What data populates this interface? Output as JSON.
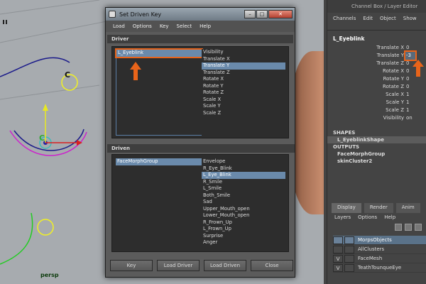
{
  "viewport": {
    "camera_label": "persp"
  },
  "channel_box": {
    "title": "Channel Box / Layer Editor",
    "menu": [
      "Channels",
      "Edit",
      "Object",
      "Show"
    ],
    "object": "L_Eyeblink",
    "attributes": [
      {
        "name": "Translate X",
        "value": "0"
      },
      {
        "name": "Translate Y",
        "value": "-3"
      },
      {
        "name": "Translate Z",
        "value": "0"
      },
      {
        "name": "Rotate X",
        "value": "0"
      },
      {
        "name": "Rotate Y",
        "value": "0"
      },
      {
        "name": "Rotate Z",
        "value": "0"
      },
      {
        "name": "Scale X",
        "value": "1"
      },
      {
        "name": "Scale Y",
        "value": "1"
      },
      {
        "name": "Scale Z",
        "value": "1"
      },
      {
        "name": "Visibility",
        "value": "on"
      }
    ],
    "shapes_header": "SHAPES",
    "shapes": [
      "L_EyeblinkShape"
    ],
    "outputs_header": "OUTPUTS",
    "outputs": [
      "FaceMorphGroup",
      "skinCluster2"
    ]
  },
  "layers": {
    "tabs": [
      "Display",
      "Render",
      "Anim"
    ],
    "menu": [
      "Layers",
      "Options",
      "Help"
    ],
    "rows": [
      {
        "v": "",
        "name": "MorpsObjects"
      },
      {
        "v": "",
        "name": "AllClusters"
      },
      {
        "v": "V",
        "name": "FaceMesh"
      },
      {
        "v": "V",
        "name": "TeathTounqueEye"
      }
    ]
  },
  "dialog": {
    "title": "Set Driven Key",
    "menu": [
      "Load",
      "Options",
      "Key",
      "Select",
      "Help"
    ],
    "driver_header": "Driver",
    "driver_nodes": [
      "L_Eyeblink"
    ],
    "driver_attrs": [
      "Visibility",
      "Translate X",
      "Translate Y",
      "Translate Z",
      "Rotate X",
      "Rotate Y",
      "Rotate Z",
      "Scale X",
      "Scale Y",
      "Scale Z"
    ],
    "driver_selected_attr": "Translate Y",
    "driven_header": "Driven",
    "driven_nodes": [
      "FaceMorphGroup"
    ],
    "driven_attrs": [
      "Envelope",
      "R_Eye_Blink",
      "L_Eye_Blink",
      "R_Smile",
      "L_Smile",
      "Both_Smile",
      "Sad",
      "Upper_Mouth_open",
      "Lower_Mouth_open",
      "R_Frown_Up",
      "L_Frown_Up",
      "Surprise",
      "Anger"
    ],
    "driven_selected_attr": "L_Eye_Blink",
    "buttons": {
      "key": "Key",
      "load_driver": "Load Driver",
      "load_driven": "Load Driven",
      "close": "Close"
    }
  },
  "colors": {
    "highlight": "#6a8aab",
    "annotation": "#e8641a"
  }
}
